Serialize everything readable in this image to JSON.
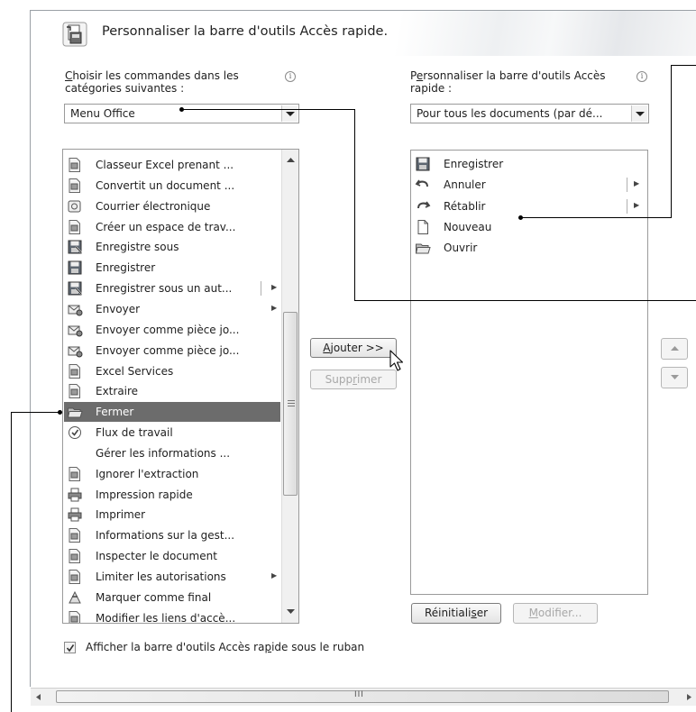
{
  "dialog": {
    "title": "Personnaliser la barre d'outils Accès rapide."
  },
  "left": {
    "label_line1_first": "C",
    "label_line1_rest": "hoisir les commandes dans les",
    "label_line2": "catégories suivantes :",
    "combo_value": "Menu Office",
    "items": [
      {
        "label": "Classeur Excel prenant ...",
        "icon": "excel-workbook-icon",
        "submenu": false
      },
      {
        "label": "Convertit un document ...",
        "icon": "convert-document-icon",
        "submenu": false
      },
      {
        "label": "Courrier électronique",
        "icon": "email-icon",
        "submenu": false
      },
      {
        "label": "Créer un espace de trav...",
        "icon": "create-workspace-icon",
        "submenu": false
      },
      {
        "label": "Enregistre sous",
        "icon": "save-as-icon",
        "submenu": false
      },
      {
        "label": "Enregistrer",
        "icon": "save-icon",
        "submenu": false
      },
      {
        "label": "Enregistrer sous un aut...",
        "icon": "save-as-other-icon",
        "submenu": true
      },
      {
        "label": "Envoyer",
        "icon": "send-icon",
        "submenu": true
      },
      {
        "label": "Envoyer comme pièce jo...",
        "icon": "send-attachment-icon",
        "submenu": false
      },
      {
        "label": "Envoyer comme pièce jo...",
        "icon": "send-attachment-pdf-icon",
        "submenu": false
      },
      {
        "label": "Excel Services",
        "icon": "excel-services-icon",
        "submenu": false
      },
      {
        "label": "Extraire",
        "icon": "extract-icon",
        "submenu": false
      },
      {
        "label": "Fermer",
        "icon": "close-folder-icon",
        "submenu": false,
        "selected": true
      },
      {
        "label": "Flux de travail",
        "icon": "workflow-icon",
        "submenu": false
      },
      {
        "label": "Gérer les informations ...",
        "icon": "",
        "submenu": false
      },
      {
        "label": "Ignorer l'extraction",
        "icon": "discard-checkout-icon",
        "submenu": false
      },
      {
        "label": "Impression rapide",
        "icon": "quick-print-icon",
        "submenu": false
      },
      {
        "label": "Imprimer",
        "icon": "print-icon",
        "submenu": false
      },
      {
        "label": "Informations sur la gest...",
        "icon": "info-management-icon",
        "submenu": false
      },
      {
        "label": "Inspecter le document",
        "icon": "inspect-document-icon",
        "submenu": false
      },
      {
        "label": "Limiter les autorisations",
        "icon": "restrict-permission-icon",
        "submenu": true
      },
      {
        "label": "Marquer comme final",
        "icon": "mark-final-icon",
        "submenu": false
      },
      {
        "label": "Modifier les liens d'accè...",
        "icon": "edit-links-icon",
        "submenu": false
      }
    ]
  },
  "middle": {
    "add_first": "A",
    "add_rest": "jouter >>",
    "remove_pre": "Supp",
    "remove_u": "r",
    "remove_post": "imer"
  },
  "right": {
    "label_line1_pre": "P",
    "label_line1_u": "e",
    "label_line1_post": "rsonnaliser la barre d'outils Accès",
    "label_line2": "rapide :",
    "combo_value": "Pour tous les documents (par dé...",
    "items": [
      {
        "label": "Enregistrer",
        "icon": "save-icon",
        "submenu": false
      },
      {
        "label": "Annuler",
        "icon": "undo-icon",
        "submenu": true
      },
      {
        "label": "Rétablir",
        "icon": "redo-icon",
        "submenu": true
      },
      {
        "label": "Nouveau",
        "icon": "new-document-icon",
        "submenu": false
      },
      {
        "label": "Ouvrir",
        "icon": "open-folder-icon",
        "submenu": false
      }
    ],
    "reset_pre": "Réinitiali",
    "reset_u": "s",
    "reset_post": "er",
    "modify_first": "M",
    "modify_rest": "odifier..."
  },
  "checkbox": {
    "label_pre": "Afficher la barre d'outils Accès ra",
    "label_u": "p",
    "label_post": "ide sous le ruban",
    "checked": true
  },
  "hscroll": {
    "thumb_glyph": "III"
  }
}
